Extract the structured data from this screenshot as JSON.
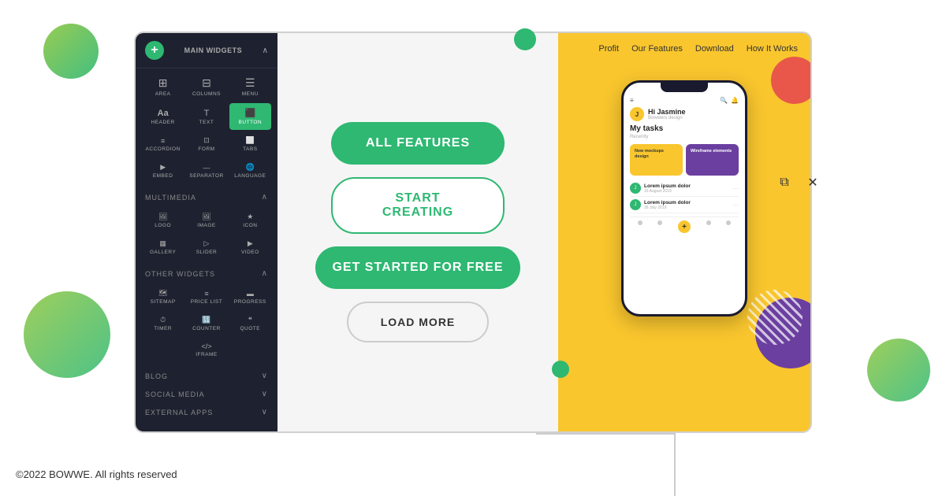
{
  "footer": {
    "copyright": "©2022 BOWWE. All rights reserved"
  },
  "sidebar": {
    "add_button_label": "+",
    "main_widgets_title": "MAIN WIDGETS",
    "multimedia_title": "MULTIMEDIA",
    "other_widgets_title": "OTHER WIDGETS",
    "blog_title": "BLOG",
    "social_media_title": "SOCIAL MEDIA",
    "external_apps_title": "EXTERNAL APPS",
    "main_widgets": [
      {
        "icon": "▦",
        "label": "AREA"
      },
      {
        "icon": "⊞",
        "label": "COLUMNS"
      },
      {
        "icon": "☰",
        "label": "MENU"
      },
      {
        "icon": "A",
        "label": "HEADER"
      },
      {
        "icon": "T",
        "label": "TEXT"
      },
      {
        "icon": "⬛",
        "label": "BUTTON",
        "active": true
      },
      {
        "icon": "≡",
        "label": "ACCORDION"
      },
      {
        "icon": "⊡",
        "label": "FORM"
      },
      {
        "icon": "⬜",
        "label": "TABS"
      },
      {
        "icon": "▶",
        "label": "EMBED"
      },
      {
        "icon": "—",
        "label": "SEPARATOR"
      },
      {
        "icon": "🌐",
        "label": "LANGUAGE"
      }
    ],
    "multimedia_widgets": [
      {
        "icon": "🖼",
        "label": "LOGO"
      },
      {
        "icon": "🖼",
        "label": "IMAGE"
      },
      {
        "icon": "★",
        "label": "ICON"
      },
      {
        "icon": "▦",
        "label": "GALLERY"
      },
      {
        "icon": "▷",
        "label": "SLIDER"
      },
      {
        "icon": "▶",
        "label": "VIDEO"
      }
    ],
    "other_widgets": [
      {
        "icon": "🗺",
        "label": "SITEMAP"
      },
      {
        "icon": "≡",
        "label": "PRICE LIST"
      },
      {
        "icon": "▬",
        "label": "PROGRESS"
      },
      {
        "icon": "⏱",
        "label": "TIMER"
      },
      {
        "icon": "🔢",
        "label": "COUNTER"
      },
      {
        "icon": "❝",
        "label": "QUOTE"
      },
      {
        "icon": "</>",
        "label": "IFRAME"
      }
    ]
  },
  "buttons": {
    "all_features": "ALL FEATURES",
    "start_creating": "START CREATING",
    "get_started": "GET STARTED FOR FREE",
    "load_more": "LOAD MORE"
  },
  "preview": {
    "nav_items": [
      "Profit",
      "Our Features",
      "Download",
      "How It Works"
    ],
    "phone": {
      "greeting": "Hi Jasmine",
      "subtitle": "Bowwers design",
      "section_title": "My tasks",
      "section_sub": "Recently",
      "card1_text": "New mockups design",
      "card2_text": "Wireframe elements",
      "list_item1_title": "Lorem ipsum dolor",
      "list_item1_date": "15 August 2019",
      "list_item2_title": "Lorem ipsum dolor",
      "list_item2_date": "26 July 2019"
    }
  },
  "resize_icons": {
    "duplicate": "⧉",
    "close": "✕"
  },
  "colors": {
    "green": "#2eb872",
    "yellow": "#f9c62e",
    "purple": "#6b3fa0",
    "coral": "#e8574a",
    "dark_green_circle": "#3a7d44",
    "light_green": "#8dc63f"
  }
}
